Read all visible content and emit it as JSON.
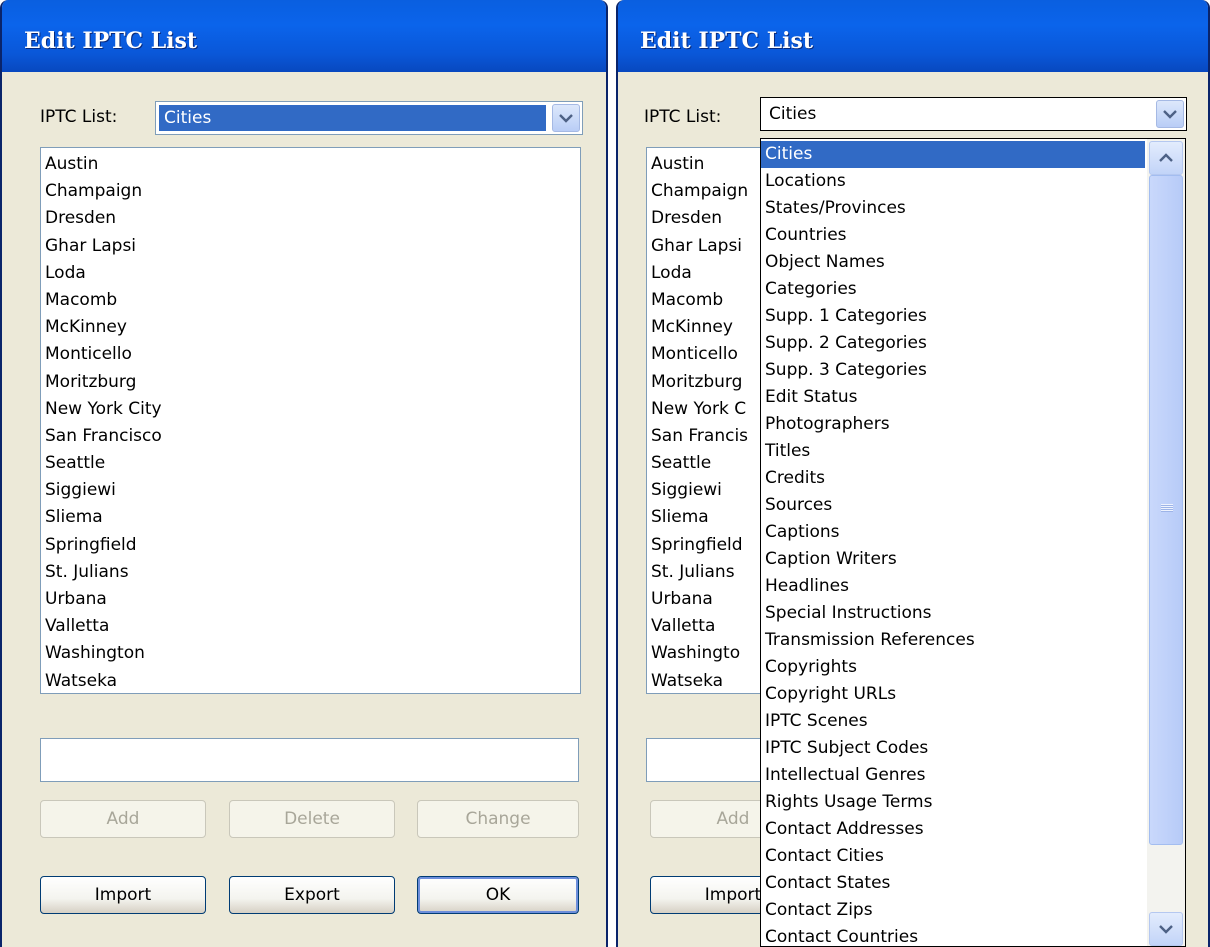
{
  "dialog_left": {
    "title": "Edit IPTC List",
    "iptc_list_label": "IPTC List:",
    "selected_list": "Cities",
    "list_items": [
      "Austin",
      "Champaign",
      "Dresden",
      "Ghar Lapsi",
      "Loda",
      "Macomb",
      "McKinney",
      "Monticello",
      "Moritzburg",
      "New York City",
      "San Francisco",
      "Seattle",
      "Siggiewi",
      "Sliema",
      "Springfield",
      "St. Julians",
      "Urbana",
      "Valletta",
      "Washington",
      "Watseka"
    ],
    "entry_value": "",
    "buttons": {
      "add": "Add",
      "delete": "Delete",
      "change": "Change",
      "import": "Import",
      "export": "Export",
      "ok": "OK"
    }
  },
  "dialog_right": {
    "title": "Edit IPTC List",
    "iptc_list_label": "IPTC List:",
    "selected_list": "Cities",
    "list_items_visible": [
      "Austin",
      "Champaign",
      "Dresden",
      "Ghar Lapsi",
      "Loda",
      "Macomb",
      "McKinney",
      "Monticello",
      "Moritzburg",
      "New York C",
      "San Francis",
      "Seattle",
      "Siggiewi",
      "Sliema",
      "Springfield",
      "St. Julians",
      "Urbana",
      "Valletta",
      "Washingto",
      "Watseka"
    ],
    "buttons_visible": {
      "add": "Add",
      "import": "Import"
    },
    "dropdown_options": [
      "Cities",
      "Locations",
      "States/Provinces",
      "Countries",
      "Object Names",
      "Categories",
      "Supp. 1 Categories",
      "Supp. 2 Categories",
      "Supp. 3 Categories",
      "Edit Status",
      "Photographers",
      "Titles",
      "Credits",
      "Sources",
      "Captions",
      "Caption Writers",
      "Headlines",
      "Special Instructions",
      "Transmission References",
      "Copyrights",
      "Copyright URLs",
      "IPTC Scenes",
      "IPTC Subject Codes",
      "Intellectual Genres",
      "Rights Usage Terms",
      "Contact Addresses",
      "Contact Cities",
      "Contact States",
      "Contact Zips",
      "Contact Countries"
    ],
    "dropdown_selected_index": 0
  },
  "colors": {
    "titlebar": "#0a5fe0",
    "selection": "#316ac5",
    "dialog_bg": "#ece9d8"
  },
  "icons": {
    "combo_arrow": "chevron-down-icon",
    "scroll_up": "chevron-up-icon",
    "scroll_down": "chevron-down-icon"
  }
}
